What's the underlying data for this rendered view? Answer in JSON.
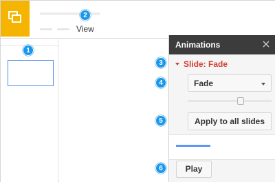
{
  "header": {
    "menu_view_label": "View"
  },
  "callouts": [
    "1",
    "2",
    "3",
    "4",
    "5",
    "6"
  ],
  "panel": {
    "title": "Animations",
    "close_icon": "close-icon",
    "section_label": "Slide: Fade",
    "effect_value": "Fade",
    "speed_level": 0.64,
    "apply_label": "Apply to all slides",
    "preview_progress": 1.0,
    "play_label": "Play"
  },
  "colors": {
    "brand": "#f4b400",
    "callout": "#1a97e8",
    "section_accent": "#d23f31",
    "panel_header": "#3c3c3c",
    "selection": "#4d8ae6",
    "progress": "#5e97f6"
  }
}
